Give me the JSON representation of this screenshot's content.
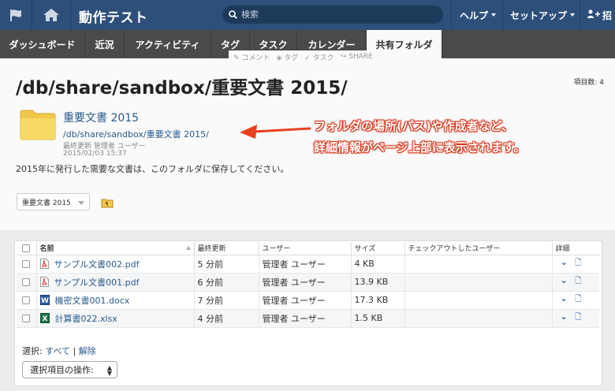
{
  "topbar": {
    "app_title": "動作テスト",
    "search_placeholder": "検索",
    "help_label": "ヘルプ",
    "setup_label": "セットアップ",
    "invite_label": "招"
  },
  "tabs": [
    {
      "label": "ダッシュボード"
    },
    {
      "label": "近況"
    },
    {
      "label": "アクティビティ"
    },
    {
      "label": "タグ"
    },
    {
      "label": "タスク"
    },
    {
      "label": "カレンダー"
    },
    {
      "label": "共有フォルダ"
    }
  ],
  "subtabs": {
    "comment": "コメント",
    "tag": "タグ",
    "task": "タスク",
    "share": "SHARE"
  },
  "page": {
    "title": "/db/share/sandbox/重要文書 2015/",
    "item_count": "項目数: 4"
  },
  "folder": {
    "name": "重要文書 2015",
    "path": "/db/share/sandbox/重要文書 2015/",
    "updated_by": "最終更新 管理者 ユーザー",
    "updated_at": "2015/02/03 15:37",
    "description": "2015年に発行した需要な文書は、このフォルダに保存してください。"
  },
  "annotation": {
    "line1": "フォルダの場所(パス)や作成者など、",
    "line2": "詳細情報がページ上部に表示されます。",
    "color": "#e8401f"
  },
  "folder_select": {
    "value": "重要文書 2015"
  },
  "table": {
    "headers": {
      "name": "名前",
      "modified": "最終更新",
      "user": "ユーザー",
      "size": "サイズ",
      "checked_out_by": "チェックアウトしたユーザー",
      "details": "詳細"
    },
    "rows": [
      {
        "icon": "pdf",
        "name": "サンプル文書002.pdf",
        "modified": "5 分前",
        "user": "管理者 ユーザー",
        "size": "4 KB",
        "checked_out_by": ""
      },
      {
        "icon": "pdf",
        "name": "サンプル文書001.pdf",
        "modified": "6 分前",
        "user": "管理者 ユーザー",
        "size": "13.9 KB",
        "checked_out_by": ""
      },
      {
        "icon": "word",
        "name": "機密文書001.docx",
        "modified": "7 分前",
        "user": "管理者 ユーザー",
        "size": "17.3 KB",
        "checked_out_by": ""
      },
      {
        "icon": "excel",
        "name": "計算書022.xlsx",
        "modified": "4 分前",
        "user": "管理者 ユーザー",
        "size": "1.5 KB",
        "checked_out_by": ""
      }
    ]
  },
  "selection": {
    "label": "選択:",
    "all": "すべて",
    "separator": "|",
    "clear": "解除",
    "action_label": "選択項目の操作:"
  }
}
